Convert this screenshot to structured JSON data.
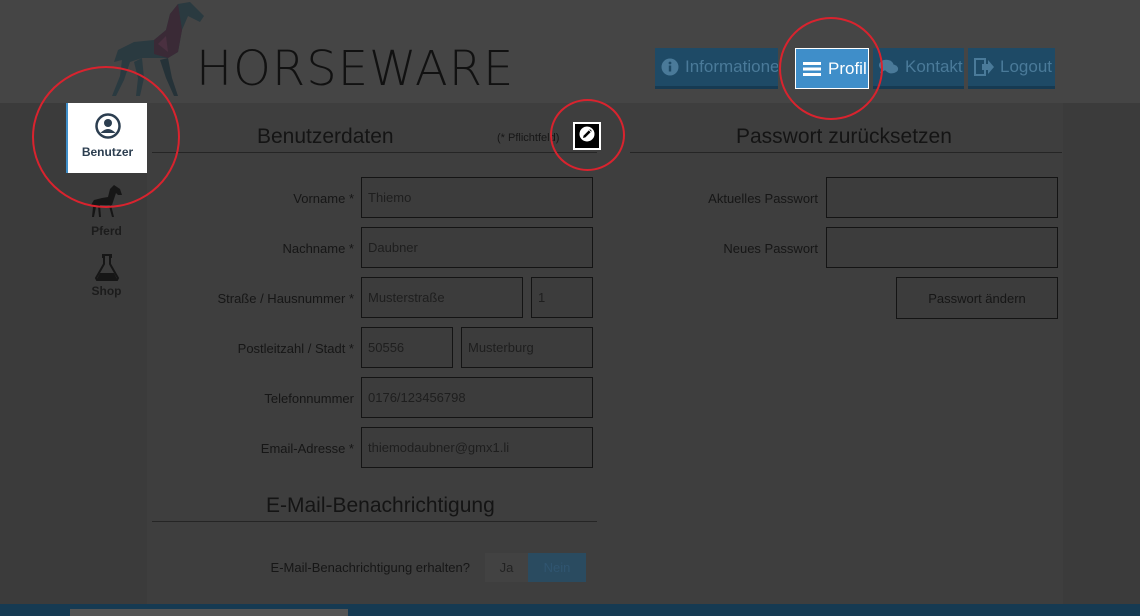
{
  "brand": {
    "name": "HORSEWARE"
  },
  "nav": {
    "info": "Informationen",
    "profile": "Profil",
    "contact": "Kontakt",
    "logout": "Logout"
  },
  "sidebar": {
    "items": [
      {
        "label": "Benutzer",
        "icon": "user-icon"
      },
      {
        "label": "Pferd",
        "icon": "horse-icon"
      },
      {
        "label": "Shop",
        "icon": "flask-icon"
      }
    ]
  },
  "user_data": {
    "title": "Benutzerdaten",
    "required_hint": "(* Pflichtfeld)",
    "fields": {
      "firstname_label": "Vorname *",
      "firstname": "Thiemo",
      "lastname_label": "Nachname *",
      "lastname": "Daubner",
      "street_label": "Straße / Hausnummer *",
      "street": "Musterstraße",
      "house_number": "1",
      "zip_label": "Postleitzahl / Stadt *",
      "zip": "50556",
      "city": "Musterburg",
      "phone_label": "Telefonnummer",
      "phone": "0176/123456798",
      "email_label": "Email-Adresse *",
      "email": "thiemodaubner@gmx1.li"
    }
  },
  "password": {
    "title": "Passwort zurücksetzen",
    "current_label": "Aktuelles Passwort",
    "new_label": "Neues Passwort",
    "submit": "Passwort ändern"
  },
  "notification": {
    "title": "E-Mail-Benachrichtigung",
    "question": "E-Mail-Benachrichtigung erhalten?",
    "yes": "Ja",
    "no": "Nein",
    "selected": "Nein"
  },
  "colors": {
    "accent": "#3f8ec9",
    "nav_bg": "#1e4a66",
    "highlight_circle": "#d9232e"
  }
}
